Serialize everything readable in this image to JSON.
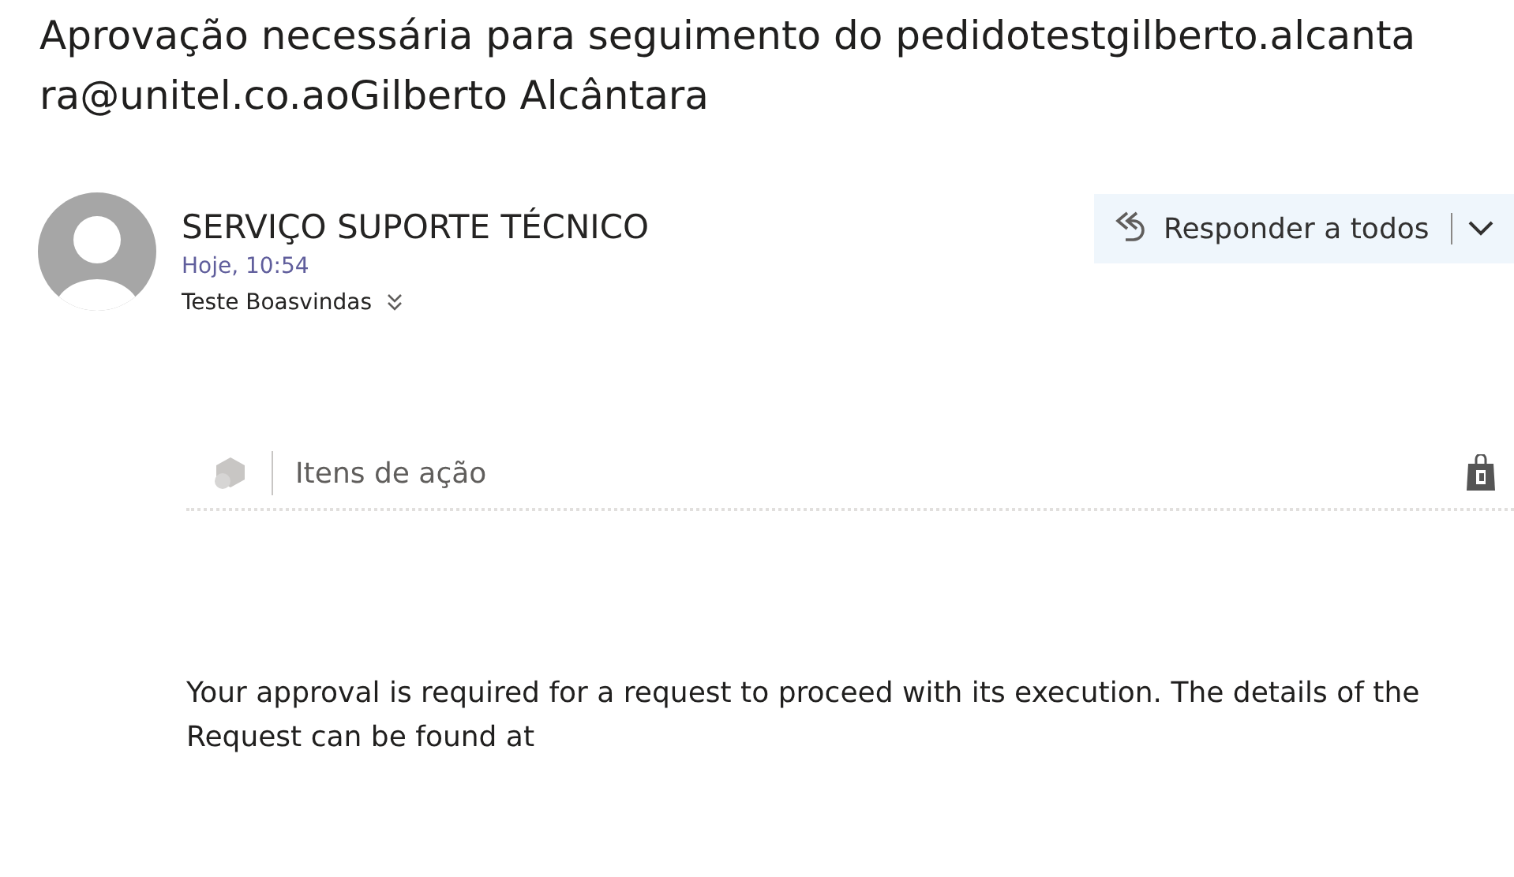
{
  "subject": "Aprovação necessária para seguimento do pedidotestgilberto.alcantara@unitel.co.aoGilberto Alcântara",
  "message": {
    "sender": "SERVIÇO SUPORTE TÉCNICO",
    "time": "Hoje, 10:54",
    "recipient": "Teste Boasvindas"
  },
  "reply_button": {
    "label": "Responder a todos"
  },
  "action_bar": {
    "label": "Itens de ação"
  },
  "body": "Your approval is required for a request to proceed with its execution. The details of the Request can be found at"
}
